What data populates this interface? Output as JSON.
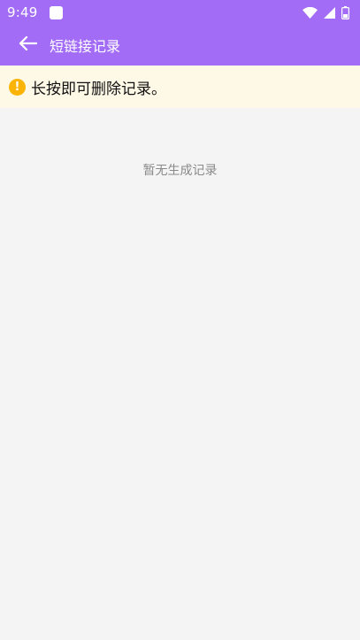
{
  "status_bar": {
    "time": "9:49",
    "icons": [
      "app-notification-icon",
      "wifi-icon",
      "cell-signal-icon",
      "battery-icon"
    ]
  },
  "app_bar": {
    "back_icon": "arrow-left-icon",
    "title": "短链接记录"
  },
  "notice": {
    "icon": "warning-circle-icon",
    "icon_glyph": "!",
    "text": "长按即可删除记录。"
  },
  "content": {
    "empty_message": "暂无生成记录"
  },
  "colors": {
    "primary": "#a36cf6",
    "notice_bg": "#fef8e6",
    "warning": "#fbb406",
    "page_bg": "#f4f4f4",
    "muted_text": "#8a8a8a"
  }
}
